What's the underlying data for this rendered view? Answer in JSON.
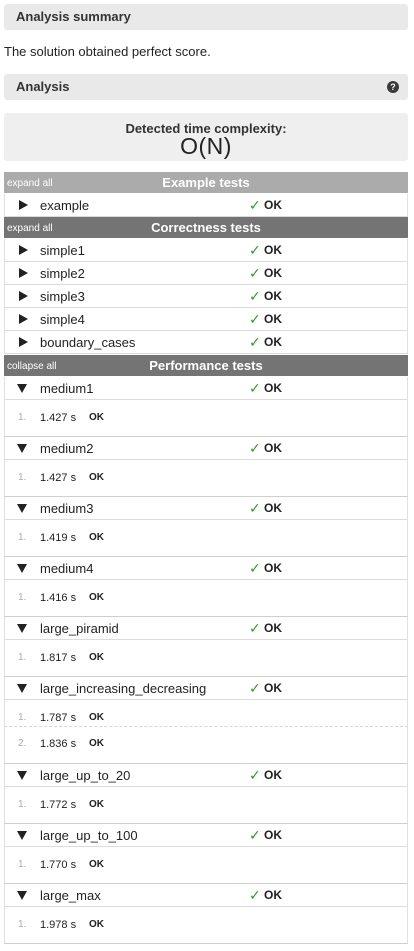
{
  "analysis_summary": {
    "title": "Analysis summary",
    "text": "The solution obtained perfect score."
  },
  "analysis": {
    "title": "Analysis",
    "help_icon": "?"
  },
  "complexity": {
    "label": "Detected time complexity:",
    "value": "O(N)"
  },
  "example_tests": {
    "title": "Example tests",
    "toggle": "expand all",
    "items": [
      {
        "name": "example",
        "check": "✓",
        "status": "OK"
      }
    ]
  },
  "correctness_tests": {
    "title": "Correctness tests",
    "toggle": "expand all",
    "items": [
      {
        "name": "simple1",
        "check": "✓",
        "status": "OK"
      },
      {
        "name": "simple2",
        "check": "✓",
        "status": "OK"
      },
      {
        "name": "simple3",
        "check": "✓",
        "status": "OK"
      },
      {
        "name": "simple4",
        "check": "✓",
        "status": "OK"
      },
      {
        "name": "boundary_cases",
        "check": "✓",
        "status": "OK"
      }
    ]
  },
  "performance_tests": {
    "title": "Performance tests",
    "toggle": "collapse all",
    "items": [
      {
        "name": "medium1",
        "check": "✓",
        "status": "OK",
        "runs": [
          {
            "num": "1.",
            "time": "1.427 s",
            "result": "OK"
          }
        ]
      },
      {
        "name": "medium2",
        "check": "✓",
        "status": "OK",
        "runs": [
          {
            "num": "1.",
            "time": "1.427 s",
            "result": "OK"
          }
        ]
      },
      {
        "name": "medium3",
        "check": "✓",
        "status": "OK",
        "runs": [
          {
            "num": "1.",
            "time": "1.419 s",
            "result": "OK"
          }
        ]
      },
      {
        "name": "medium4",
        "check": "✓",
        "status": "OK",
        "runs": [
          {
            "num": "1.",
            "time": "1.416 s",
            "result": "OK"
          }
        ]
      },
      {
        "name": "large_piramid",
        "check": "✓",
        "status": "OK",
        "runs": [
          {
            "num": "1.",
            "time": "1.817 s",
            "result": "OK"
          }
        ]
      },
      {
        "name": "large_increasing_decreasing",
        "check": "✓",
        "status": "OK",
        "runs": [
          {
            "num": "1.",
            "time": "1.787 s",
            "result": "OK"
          },
          {
            "num": "2.",
            "time": "1.836 s",
            "result": "OK"
          }
        ]
      },
      {
        "name": "large_up_to_20",
        "check": "✓",
        "status": "OK",
        "runs": [
          {
            "num": "1.",
            "time": "1.772 s",
            "result": "OK"
          }
        ]
      },
      {
        "name": "large_up_to_100",
        "check": "✓",
        "status": "OK",
        "runs": [
          {
            "num": "1.",
            "time": "1.770 s",
            "result": "OK"
          }
        ]
      },
      {
        "name": "large_max",
        "check": "✓",
        "status": "OK",
        "runs": [
          {
            "num": "1.",
            "time": "1.978 s",
            "result": "OK"
          }
        ]
      }
    ]
  }
}
